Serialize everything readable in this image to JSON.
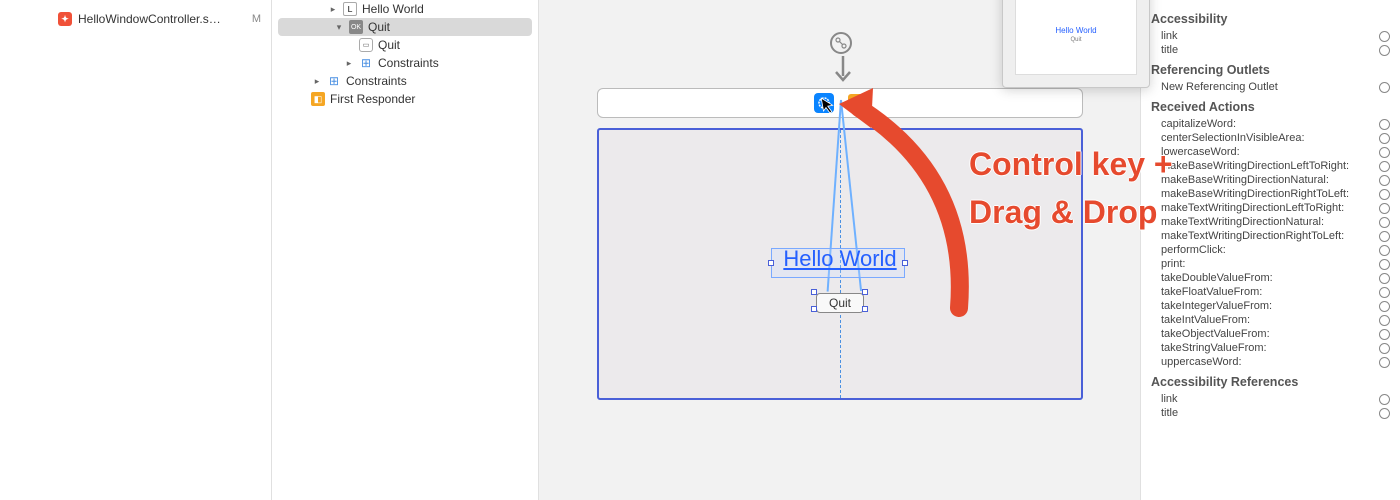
{
  "filenav": {
    "file": {
      "name": "HelloWindowController.s…",
      "badge": "M"
    }
  },
  "outline": {
    "items": [
      {
        "indent": 3,
        "disclosure": "right",
        "icon": "label",
        "label": "Hello World"
      },
      {
        "indent": 3,
        "disclosure": "down",
        "icon": "ok",
        "label": "Quit",
        "selected": true
      },
      {
        "indent": 4,
        "disclosure": "",
        "icon": "button",
        "label": "Quit"
      },
      {
        "indent": 4,
        "disclosure": "right",
        "icon": "constraints",
        "label": "Constraints"
      },
      {
        "indent": 2,
        "disclosure": "right",
        "icon": "constraints",
        "label": "Constraints"
      },
      {
        "indent": 1,
        "disclosure": "",
        "icon": "cube",
        "label": "First Responder"
      }
    ]
  },
  "canvas": {
    "label_text": "Hello World",
    "button_text": "Quit",
    "thumb_label": "Hello World",
    "thumb_button": "Quit"
  },
  "annotation": {
    "line1": "Control key +",
    "line2": "Drag & Drop"
  },
  "inspector": {
    "sections": [
      {
        "title": "Accessibility",
        "rows": [
          "link",
          "title"
        ]
      },
      {
        "title": "Referencing Outlets",
        "rows": [
          "New Referencing Outlet"
        ]
      },
      {
        "title": "Received Actions",
        "rows": [
          "capitalizeWord:",
          "centerSelectionInVisibleArea:",
          "lowercaseWord:",
          "makeBaseWritingDirectionLeftToRight:",
          "makeBaseWritingDirectionNatural:",
          "makeBaseWritingDirectionRightToLeft:",
          "makeTextWritingDirectionLeftToRight:",
          "makeTextWritingDirectionNatural:",
          "makeTextWritingDirectionRightToLeft:",
          "performClick:",
          "print:",
          "takeDoubleValueFrom:",
          "takeFloatValueFrom:",
          "takeIntegerValueFrom:",
          "takeIntValueFrom:",
          "takeObjectValueFrom:",
          "takeStringValueFrom:",
          "uppercaseWord:"
        ]
      },
      {
        "title": "Accessibility References",
        "rows": [
          "link",
          "title"
        ]
      }
    ]
  }
}
